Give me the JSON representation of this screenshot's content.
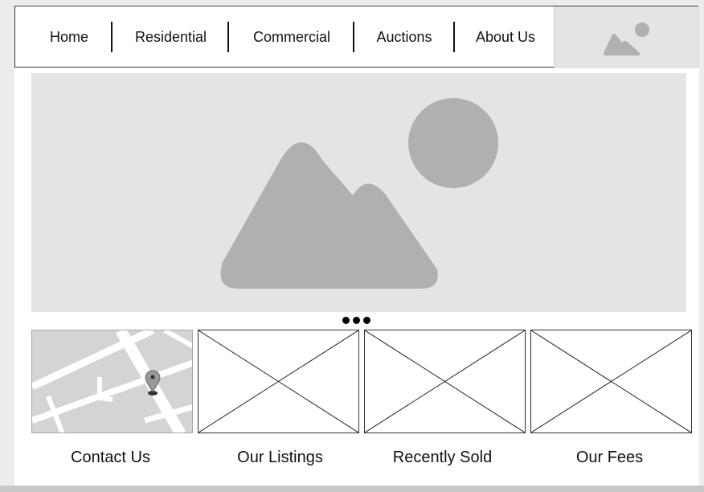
{
  "nav": {
    "items": [
      {
        "label": "Home"
      },
      {
        "label": "Residential"
      },
      {
        "label": "Commercial"
      },
      {
        "label": "Auctions"
      },
      {
        "label": "About Us"
      }
    ]
  },
  "logo": {
    "icon": "image-placeholder-icon"
  },
  "hero": {
    "icon": "image-placeholder-icon",
    "background": "#e4e4e4",
    "shape_color": "#b0b0b0"
  },
  "carousel": {
    "dot_count": 3
  },
  "tiles": [
    {
      "caption": "Contact Us",
      "icon": "map-icon"
    },
    {
      "caption": "Our Listings",
      "icon": "image-placeholder-x"
    },
    {
      "caption": "Recently Sold",
      "icon": "image-placeholder-x"
    },
    {
      "caption": "Our Fees",
      "icon": "image-placeholder-x"
    }
  ]
}
